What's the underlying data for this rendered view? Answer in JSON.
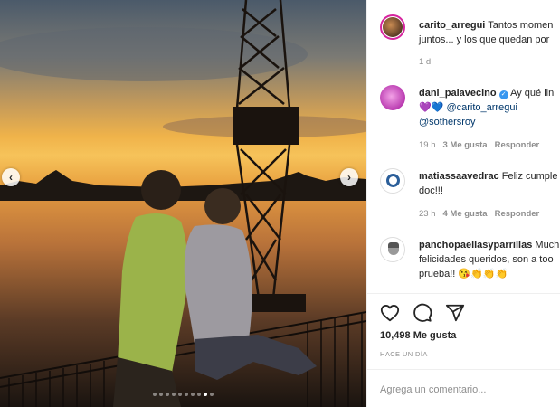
{
  "post": {
    "author": "carito_arregui",
    "caption_line1": "Tantos momen",
    "caption_line2": "juntos... y los que quedan por",
    "age": "1 d",
    "photo_dots": 10,
    "photo_active_dot": 8
  },
  "comments": [
    {
      "user": "dani_palavecino",
      "line1": "Ay qué lin",
      "line2_emoji": "💜💙",
      "mention1": "@carito_arregui",
      "mention2": "@sothersroy",
      "age": "19 h",
      "likes": "3 Me gusta",
      "reply": "Responder"
    },
    {
      "user": "matiassaavedrac",
      "line1": "Feliz cumple",
      "line2": "doc!!!",
      "age": "23 h",
      "likes": "4 Me gusta",
      "reply": "Responder"
    },
    {
      "user": "panchopaellasyparrillas",
      "line1": "Much",
      "line2": "felicidades queridos, son a too",
      "line3": "prueba!! 😘👏👏👏"
    }
  ],
  "footer": {
    "likes": "10,498 Me gusta",
    "ago": "HACE UN DÍA",
    "add_comment_placeholder": "Agrega un comentario..."
  },
  "icons": {
    "like": "heart-icon",
    "comment": "comment-bubble-icon",
    "share": "paper-plane-icon",
    "prev": "chevron-left-icon",
    "next": "chevron-right-icon"
  },
  "colors": {
    "mention": "#00376b",
    "verified": "#3897f0",
    "muted": "#8e8e8e",
    "story_ring": "#d6249f"
  }
}
